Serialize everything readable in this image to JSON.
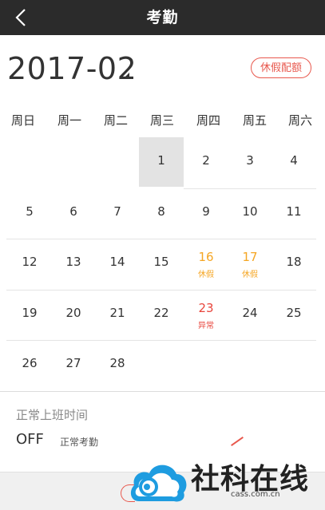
{
  "header": {
    "title": "考勤"
  },
  "calendar": {
    "month_label": "2017-02",
    "vacation_button": "休假配额",
    "weekdays": [
      "周日",
      "周一",
      "周二",
      "周三",
      "周四",
      "周五",
      "周六"
    ],
    "selected_day": "1",
    "weeks": [
      [
        {
          "d": ""
        },
        {
          "d": ""
        },
        {
          "d": ""
        },
        {
          "d": "1",
          "selected": true
        },
        {
          "d": "2"
        },
        {
          "d": "3"
        },
        {
          "d": "4"
        }
      ],
      [
        {
          "d": "5"
        },
        {
          "d": "6"
        },
        {
          "d": "7"
        },
        {
          "d": "8"
        },
        {
          "d": "9"
        },
        {
          "d": "10"
        },
        {
          "d": "11"
        }
      ],
      [
        {
          "d": "12"
        },
        {
          "d": "13"
        },
        {
          "d": "14"
        },
        {
          "d": "15"
        },
        {
          "d": "16",
          "sub": "休假",
          "status": "vacation"
        },
        {
          "d": "17",
          "sub": "休假",
          "status": "vacation"
        },
        {
          "d": "18"
        }
      ],
      [
        {
          "d": "19"
        },
        {
          "d": "20"
        },
        {
          "d": "21"
        },
        {
          "d": "22"
        },
        {
          "d": "23",
          "sub": "异常",
          "status": "abnormal"
        },
        {
          "d": "24"
        },
        {
          "d": "25"
        }
      ],
      [
        {
          "d": "26"
        },
        {
          "d": "27"
        },
        {
          "d": "28"
        },
        {
          "d": ""
        },
        {
          "d": ""
        },
        {
          "d": ""
        },
        {
          "d": ""
        }
      ]
    ],
    "colors": {
      "vacation": "#f5a623",
      "abnormal": "#e8453c"
    }
  },
  "schedule": {
    "label": "正常上班时间",
    "value": "OFF",
    "tag": "正常考勤"
  },
  "watermark": {
    "text": "社科在线",
    "url": "cass.com.cn"
  }
}
